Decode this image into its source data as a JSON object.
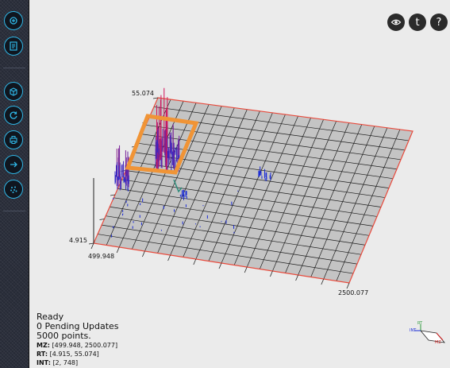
{
  "sidebar": {
    "buttons": [
      {
        "name": "open-file-button",
        "icon": "open-icon"
      },
      {
        "name": "notes-button",
        "icon": "notes-icon"
      },
      {
        "name": "view-3d-button",
        "icon": "cube-icon"
      },
      {
        "name": "reset-button",
        "icon": "refresh-icon"
      },
      {
        "name": "print-button",
        "icon": "printer-icon"
      },
      {
        "name": "forward-button",
        "icon": "arrow-right-icon"
      },
      {
        "name": "peaks-button",
        "icon": "dots-icon"
      }
    ]
  },
  "top_controls": {
    "visibility_icon": "eye-icon",
    "t_label": "t",
    "help_label": "?"
  },
  "axes": {
    "rt_max": "55.074",
    "rt_min": "4.915",
    "mz_min": "499.948",
    "mz_max": "2500.077"
  },
  "status": {
    "state": "Ready",
    "pending": "0 Pending Updates",
    "points": "5000 points.",
    "mz_label": "MZ:",
    "mz_range": "[499.948, 2500.077]",
    "rt_label": "RT:",
    "rt_range": "[4.915, 55.074]",
    "int_label": "INT:",
    "int_range": "[2, 748]"
  },
  "gizmo": {
    "rt_label": "RT",
    "int_label": "INT",
    "mz_label": "MZ"
  },
  "colors": {
    "accent": "#2fb6e6",
    "selection": "#f09436",
    "plane_border": "#e84a3c",
    "peaks_high": "#d4145a",
    "peaks_low": "#1a2bd6"
  }
}
